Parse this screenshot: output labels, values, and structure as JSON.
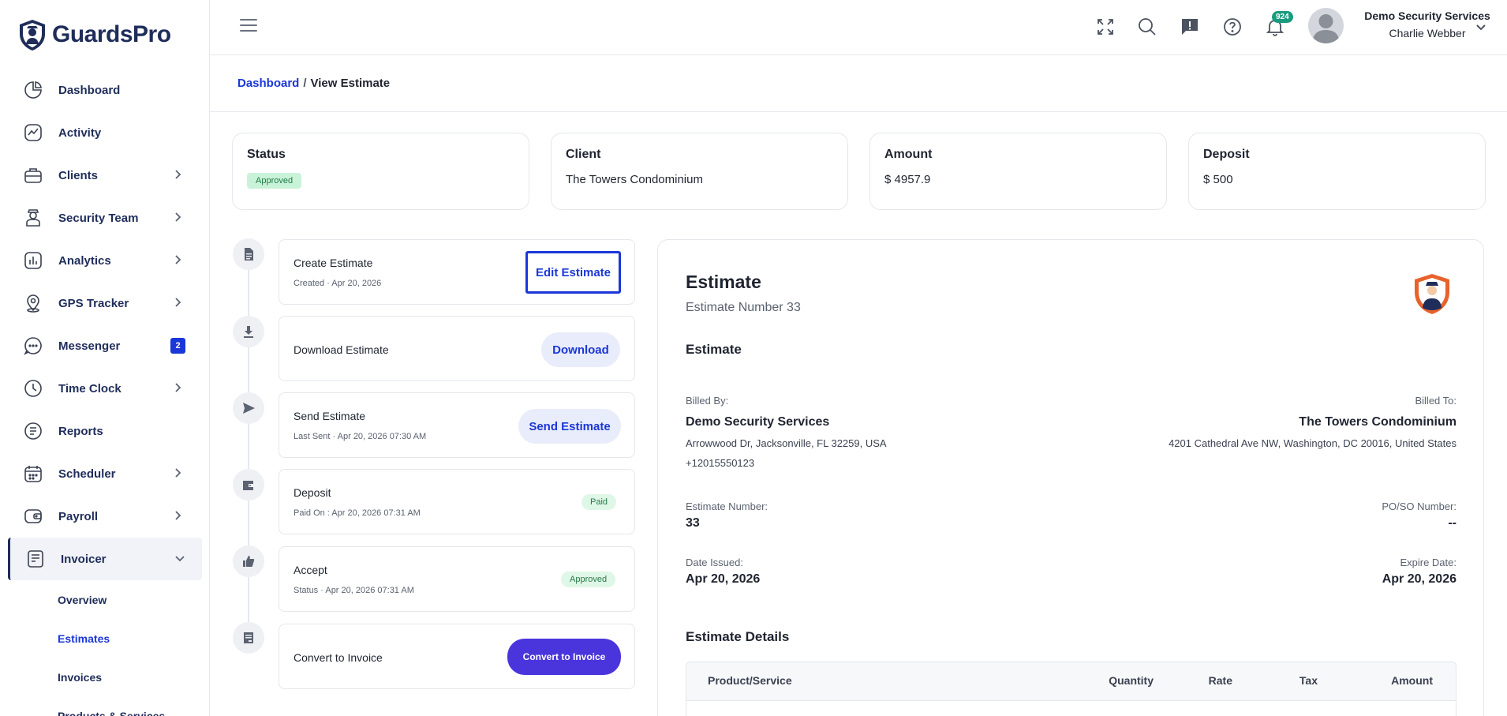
{
  "app": {
    "name": "GuardsPro"
  },
  "sidebar": {
    "items": [
      {
        "label": "Dashboard",
        "icon": "chart-pie-icon",
        "has_chevron": false
      },
      {
        "label": "Activity",
        "icon": "activity-icon",
        "has_chevron": false
      },
      {
        "label": "Clients",
        "icon": "briefcase-icon",
        "has_chevron": true
      },
      {
        "label": "Security Team",
        "icon": "guard-icon",
        "has_chevron": true
      },
      {
        "label": "Analytics",
        "icon": "bar-chart-icon",
        "has_chevron": true
      },
      {
        "label": "GPS Tracker",
        "icon": "location-pin-icon",
        "has_chevron": true
      },
      {
        "label": "Messenger",
        "icon": "chat-bubble-icon",
        "badge": "2"
      },
      {
        "label": "Time Clock",
        "icon": "clock-icon",
        "has_chevron": true
      },
      {
        "label": "Reports",
        "icon": "document-list-icon",
        "has_chevron": false
      },
      {
        "label": "Scheduler",
        "icon": "calendar-icon",
        "has_chevron": true
      },
      {
        "label": "Payroll",
        "icon": "wallet-icon",
        "has_chevron": true
      },
      {
        "label": "Invoicer",
        "icon": "receipt-icon",
        "expanded": true
      }
    ],
    "sub_items": [
      {
        "label": "Overview"
      },
      {
        "label": "Estimates",
        "active": true
      },
      {
        "label": "Invoices"
      },
      {
        "label": "Products & Services"
      }
    ]
  },
  "topbar": {
    "notification_count": "924",
    "user_company": "Demo Security Services",
    "user_name": "Charlie Webber"
  },
  "breadcrumb": {
    "root": "Dashboard",
    "separator": "/",
    "current": "View Estimate"
  },
  "summary": {
    "status": {
      "title": "Status",
      "value": "Approved"
    },
    "client": {
      "title": "Client",
      "value": "The Towers Condominium"
    },
    "amount": {
      "title": "Amount",
      "value": "$ 4957.9"
    },
    "deposit": {
      "title": "Deposit",
      "value": "$ 500"
    }
  },
  "steps": {
    "create": {
      "title": "Create Estimate",
      "sub": "Created · Apr 20, 2026",
      "button": "Edit Estimate"
    },
    "download": {
      "title": "Download Estimate",
      "button": "Download"
    },
    "send": {
      "title": "Send Estimate",
      "sub": "Last Sent · Apr 20, 2026 07:30 AM",
      "button": "Send Estimate"
    },
    "deposit": {
      "title": "Deposit",
      "sub": "Paid On : Apr 20, 2026 07:31 AM",
      "badge": "Paid"
    },
    "accept": {
      "title": "Accept",
      "sub": "Status · Apr 20, 2026 07:31 AM",
      "badge": "Approved"
    },
    "convert": {
      "title": "Convert to Invoice",
      "button": "Convert to Invoice"
    }
  },
  "estimate": {
    "title": "Estimate",
    "number_line": "Estimate Number 33",
    "section_title": "Estimate",
    "billed_by_label": "Billed By:",
    "billed_by_name": "Demo Security Services",
    "billed_by_address": "Arrowwood Dr, Jacksonville, FL 32259, USA",
    "billed_by_phone": "+12015550123",
    "billed_to_label": "Billed To:",
    "billed_to_name": "The Towers Condominium",
    "billed_to_address": "4201 Cathedral Ave NW, Washington, DC 20016, United States",
    "number_label": "Estimate Number:",
    "number_value": "33",
    "po_label": "PO/SO Number:",
    "po_value": "--",
    "issued_label": "Date Issued:",
    "issued_value": "Apr 20, 2026",
    "expire_label": "Expire Date:",
    "expire_value": "Apr 20, 2026",
    "details_title": "Estimate Details",
    "columns": [
      "Product/Service",
      "Quantity",
      "Rate",
      "Tax",
      "Amount"
    ]
  },
  "colors": {
    "accent": "#1a37d8",
    "brand_dark": "#1f2d5a",
    "approved_bg": "#c9f3d9",
    "convert_button": "#4a35dd",
    "notification_badge": "#1a9b7e"
  }
}
